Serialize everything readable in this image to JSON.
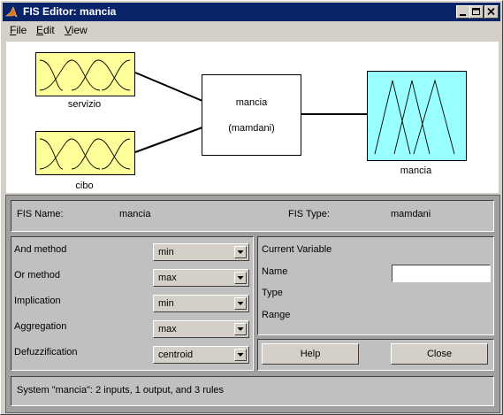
{
  "window": {
    "title": "FIS Editor: mancia"
  },
  "menu": [
    {
      "key": "F",
      "rest": "ile"
    },
    {
      "key": "E",
      "rest": "dit"
    },
    {
      "key": "V",
      "rest": "iew"
    }
  ],
  "diagram": {
    "inputs": [
      {
        "name": "servizio"
      },
      {
        "name": "cibo"
      }
    ],
    "system": {
      "name": "mancia",
      "type_label": "(mamdani)"
    },
    "output": {
      "name": "mancia"
    },
    "colors": {
      "input_fill": "#ffff99",
      "output_fill": "#99ffff",
      "system_fill": "#ffffff"
    }
  },
  "info": {
    "fis_name_label": "FIS Name:",
    "fis_name": "mancia",
    "fis_type_label": "FIS Type:",
    "fis_type": "mamdani"
  },
  "methods": [
    {
      "label": "And method",
      "value": "min"
    },
    {
      "label": "Or method",
      "value": "max"
    },
    {
      "label": "Implication",
      "value": "min"
    },
    {
      "label": "Aggregation",
      "value": "max"
    },
    {
      "label": "Defuzzification",
      "value": "centroid"
    }
  ],
  "current_variable": {
    "title": "Current Variable",
    "name_label": "Name",
    "name_value": "",
    "type_label": "Type",
    "range_label": "Range"
  },
  "buttons": {
    "help": "Help",
    "close": "Close"
  },
  "status": "System \"mancia\": 2 inputs, 1 output, and 3 rules"
}
